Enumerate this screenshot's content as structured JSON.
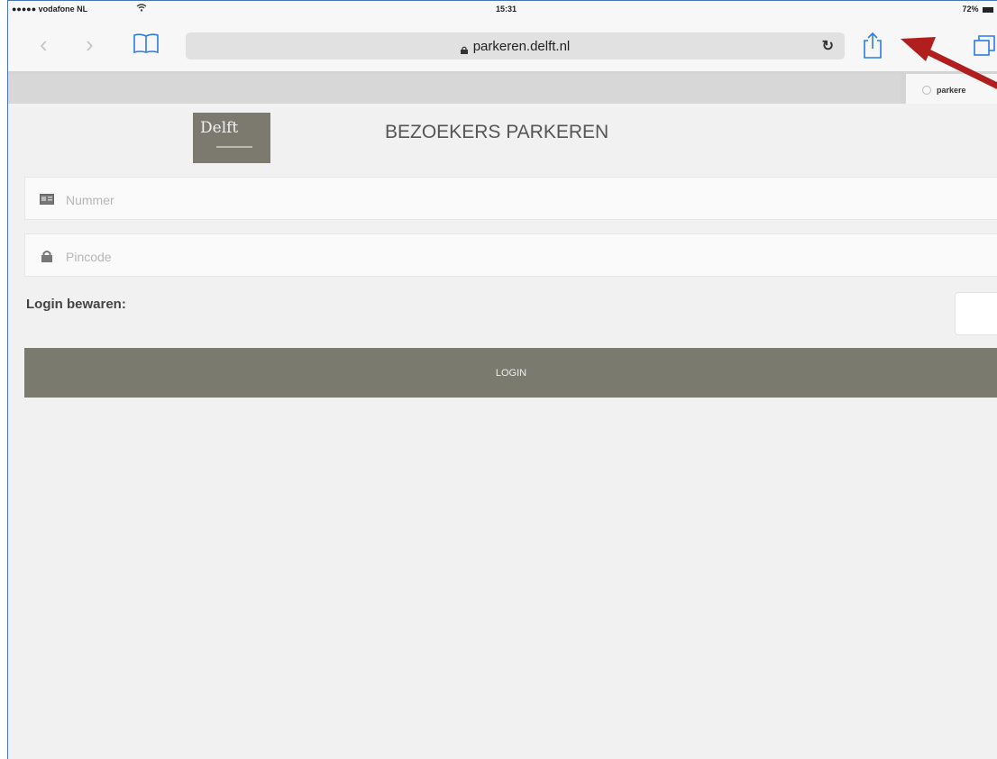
{
  "status_bar": {
    "carrier": "●●●●● vodafone NL",
    "time": "15:31",
    "battery": "72%"
  },
  "toolbar": {
    "url": "parkeren.delft.nl"
  },
  "tab": {
    "label": "parkere"
  },
  "page": {
    "logo_text": "Delft",
    "title": "BEZOEKERS PARKEREN",
    "number_placeholder": "Nummer",
    "pin_placeholder": "Pincode",
    "remember_label": "Login bewaren:",
    "login_label": "LOGIN"
  },
  "colors": {
    "arrow": "#b01e1e",
    "button": "#7a7a6f",
    "link_blue": "#2c7be5"
  }
}
